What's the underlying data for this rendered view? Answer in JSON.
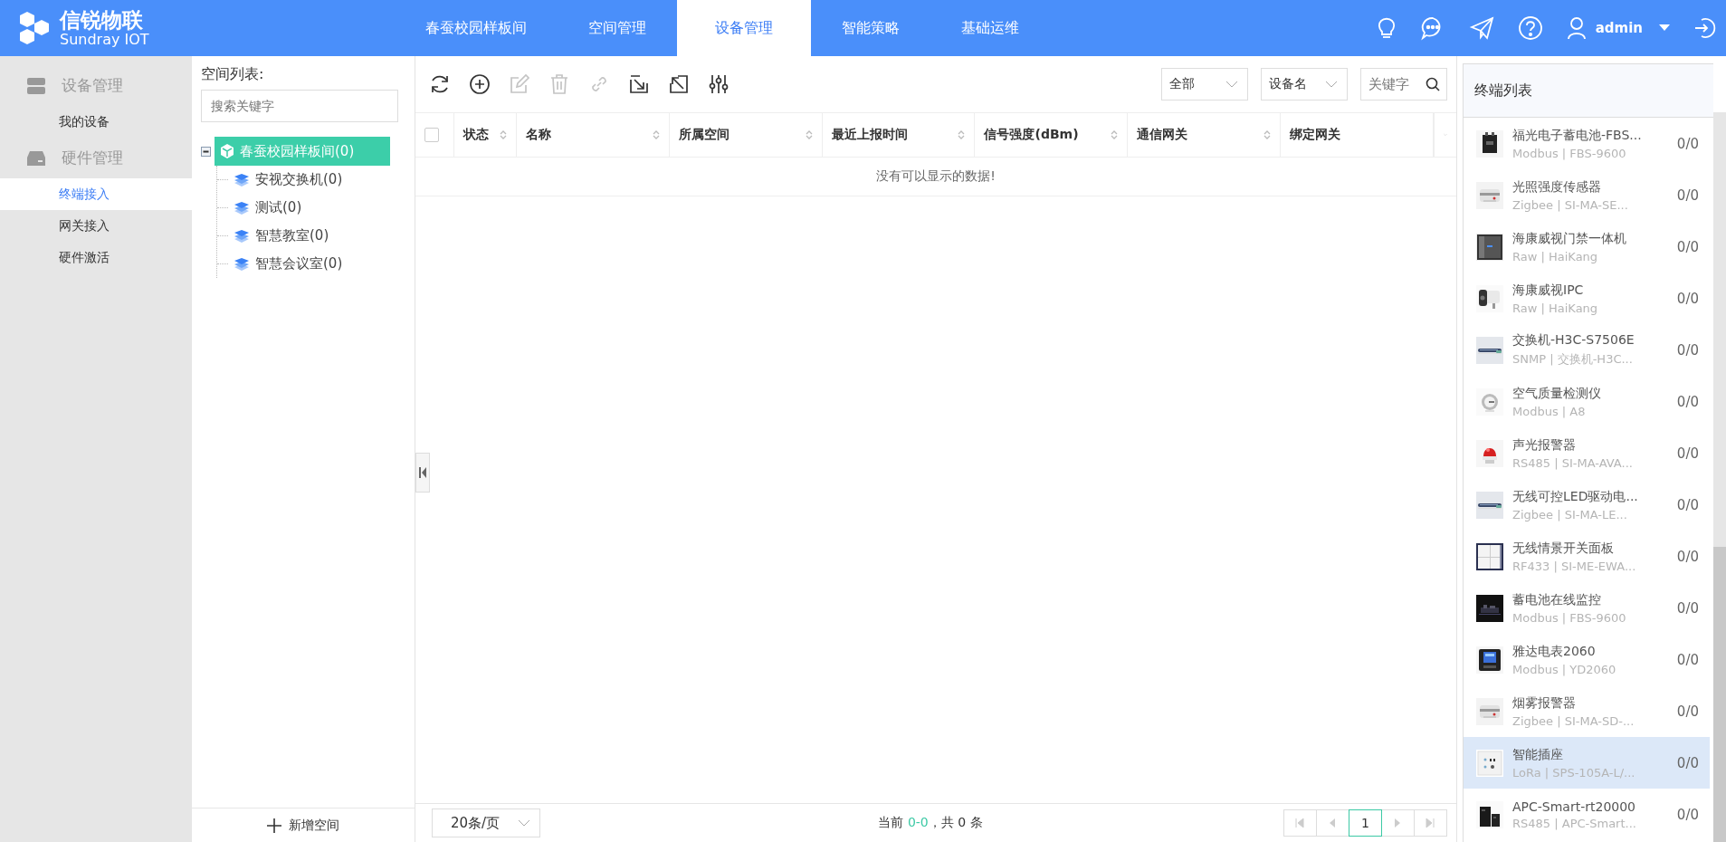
{
  "brand": {
    "name": "信锐物联",
    "tagline": "Sundray IOT"
  },
  "nav": [
    {
      "label": "春蚕校园样板间",
      "selected": false
    },
    {
      "label": "空间管理",
      "selected": false
    },
    {
      "label": "设备管理",
      "selected": true
    },
    {
      "label": "智能策略",
      "selected": false
    },
    {
      "label": "基础运维",
      "selected": false
    }
  ],
  "user": {
    "name": "admin"
  },
  "sidebar": [
    {
      "title": "设备管理",
      "kind": "server",
      "items": [
        {
          "label": "我的设备",
          "selected": false
        }
      ]
    },
    {
      "title": "硬件管理",
      "kind": "drive",
      "items": [
        {
          "label": "终端接入",
          "selected": true
        },
        {
          "label": "网关接入",
          "selected": false
        },
        {
          "label": "硬件激活",
          "selected": false
        }
      ]
    }
  ],
  "space_tree": {
    "title": "空间列表:",
    "placeholder": "搜索关键字",
    "add_label": "新增空间",
    "nodes": [
      {
        "label": "春蚕校园样板间(0)",
        "selected": true,
        "expanded": true,
        "children": [
          {
            "label": "安视交换机(0)",
            "selected": false
          },
          {
            "label": "测试(0)",
            "selected": false
          },
          {
            "label": "智慧教室(0)",
            "selected": false
          },
          {
            "label": "智慧会议室(0)",
            "selected": false
          }
        ]
      }
    ]
  },
  "toolbar": [
    {
      "kind": "refresh",
      "disabled": false
    },
    {
      "kind": "add",
      "disabled": false
    },
    {
      "kind": "edit",
      "disabled": true
    },
    {
      "kind": "delete",
      "disabled": true
    },
    {
      "kind": "link",
      "disabled": true
    },
    {
      "kind": "import",
      "disabled": false
    },
    {
      "kind": "export",
      "disabled": false
    },
    {
      "kind": "columns",
      "disabled": false
    }
  ],
  "filters": {
    "scope": "全部",
    "field": "设备名",
    "placeholder": "关键字"
  },
  "table": {
    "checked": false,
    "columns": [
      {
        "label": "状态",
        "sortable": true
      },
      {
        "label": "名称",
        "sortable": true
      },
      {
        "label": "所属空间",
        "sortable": true
      },
      {
        "label": "最近上报时间",
        "sortable": true
      },
      {
        "label": "信号强度(dBm)",
        "sortable": true
      },
      {
        "label": "通信网关",
        "sortable": true
      },
      {
        "label": "绑定网关",
        "sortable": false
      }
    ],
    "empty": "没有可以显示的数据!"
  },
  "pager": {
    "page_size": "20条/页",
    "prefix": "当前 ",
    "range": "0-0",
    "suffix": "，共 0 条",
    "pages": [
      {
        "label": "1",
        "selected": true
      }
    ]
  },
  "terminal_list": {
    "title": "终端列表",
    "items": [
      {
        "name": "福光电子蓄电池-FBS...",
        "sub": "Modbus | FBS-9600",
        "count": "0/0",
        "selected": false
      },
      {
        "name": "光照强度传感器",
        "sub": "Zigbee | SI-MA-SE...",
        "count": "0/0",
        "selected": false
      },
      {
        "name": "海康威视门禁一体机",
        "sub": "Raw | HaiKang",
        "count": "0/0",
        "selected": false
      },
      {
        "name": "海康威视IPC",
        "sub": "Raw | HaiKang",
        "count": "0/0",
        "selected": false
      },
      {
        "name": "交换机-H3C-S7506E",
        "sub": "SNMP | 交换机-H3C...",
        "count": "0/0",
        "selected": false
      },
      {
        "name": "空气质量检测仪",
        "sub": "Modbus | A8",
        "count": "0/0",
        "selected": false
      },
      {
        "name": "声光报警器",
        "sub": "RS485 | SI-MA-AVA...",
        "count": "0/0",
        "selected": false
      },
      {
        "name": "无线可控LED驱动电...",
        "sub": "Zigbee | SI-MA-LE...",
        "count": "0/0",
        "selected": false
      },
      {
        "name": "无线情景开关面板",
        "sub": "RF433 | SI-ME-EWA...",
        "count": "0/0",
        "selected": false
      },
      {
        "name": "蓄电池在线监控",
        "sub": "Modbus | FBS-9600",
        "count": "0/0",
        "selected": false
      },
      {
        "name": "雅达电表2060",
        "sub": "Modbus | YD2060",
        "count": "0/0",
        "selected": false
      },
      {
        "name": "烟雾报警器",
        "sub": "Zigbee | SI-MA-SD-...",
        "count": "0/0",
        "selected": false
      },
      {
        "name": "智能插座",
        "sub": "LoRa | SPS-105A-L/...",
        "count": "0/0",
        "selected": true
      },
      {
        "name": "APC-Smart-rt20000",
        "sub": "RS485 | APC-Smart...",
        "count": "0/0",
        "selected": false
      }
    ]
  }
}
